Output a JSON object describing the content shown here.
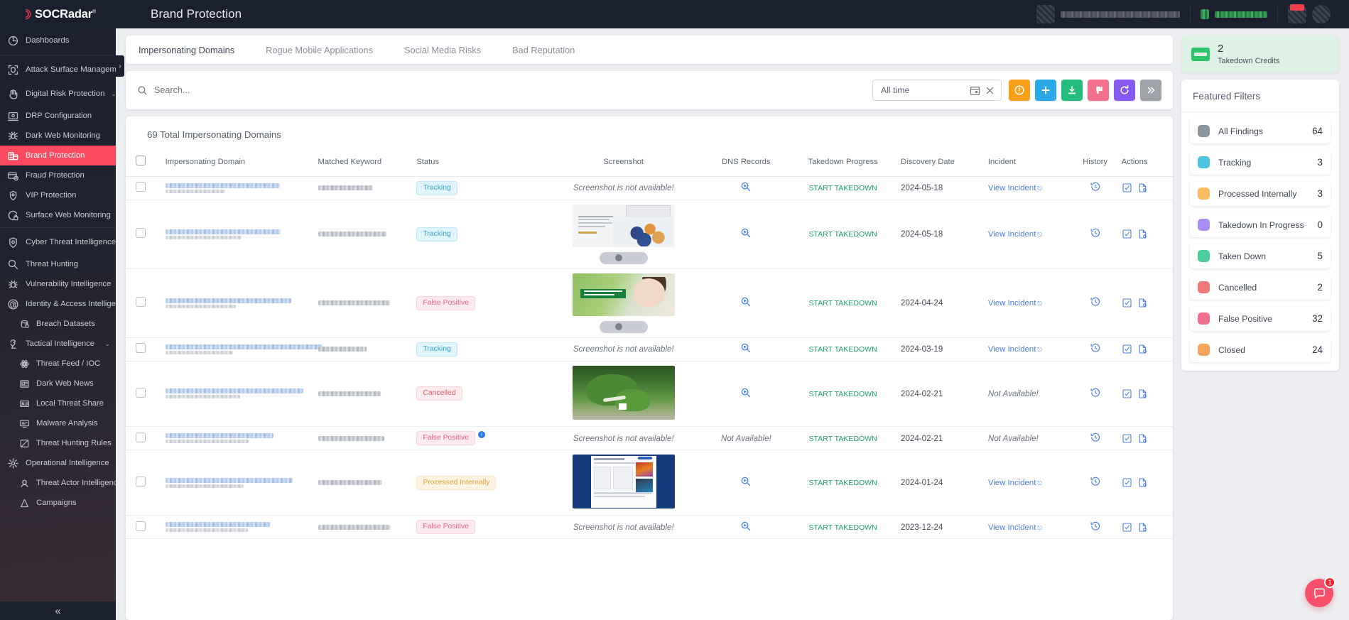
{
  "header": {
    "logo_text": "SOCRadar",
    "logo_sup": "®",
    "page_title": "Brand Protection",
    "avatar_icon": "user-avatar",
    "globe_icon": "globe-icon"
  },
  "sidebar": {
    "collapse_label": "«",
    "flyout_label": "›",
    "items": [
      {
        "label": "Dashboards",
        "icon": "dashboard-icon",
        "type": "header",
        "active": false,
        "chevron": ""
      },
      {
        "label": "Attack Surface Management",
        "icon": "shield-scan-icon",
        "type": "header",
        "active": false,
        "chevron": "›"
      },
      {
        "label": "Digital Risk Protection",
        "icon": "hand-icon",
        "type": "header",
        "active": false,
        "chevron": "⌄"
      },
      {
        "label": "DRP Configuration",
        "icon": "monitor-icon",
        "type": "item",
        "active": false,
        "chevron": ""
      },
      {
        "label": "Dark Web Monitoring",
        "icon": "spider-icon",
        "type": "item",
        "active": false,
        "chevron": ""
      },
      {
        "label": "Brand Protection",
        "icon": "building-icon",
        "type": "item",
        "active": true,
        "chevron": ""
      },
      {
        "label": "Fraud Protection",
        "icon": "card-fraud-icon",
        "type": "item",
        "active": false,
        "chevron": ""
      },
      {
        "label": "VIP Protection",
        "icon": "shield-person-icon",
        "type": "item",
        "active": false,
        "chevron": ""
      },
      {
        "label": "Surface Web Monitoring",
        "icon": "web-lock-icon",
        "type": "item",
        "active": false,
        "chevron": ""
      },
      {
        "label": "Cyber Threat Intelligence",
        "icon": "eye-shield-icon",
        "type": "header",
        "active": false,
        "chevron": "⌄",
        "badge": "?"
      },
      {
        "label": "Threat Hunting",
        "icon": "search-icon",
        "type": "item",
        "active": false,
        "chevron": ""
      },
      {
        "label": "Vulnerability Intelligence",
        "icon": "bug-icon",
        "type": "item",
        "active": false,
        "chevron": ""
      },
      {
        "label": "Identity & Access Intelligence",
        "icon": "fingerprint-icon",
        "type": "item",
        "active": false,
        "chevron": "⌄"
      },
      {
        "label": "Breach Datasets",
        "icon": "database-lock-icon",
        "type": "sub",
        "active": false,
        "chevron": ""
      },
      {
        "label": "Tactical Intelligence",
        "icon": "chess-icon",
        "type": "item",
        "active": false,
        "chevron": "⌄"
      },
      {
        "label": "Threat Feed / IOC",
        "icon": "atom-icon",
        "type": "sub",
        "active": false,
        "chevron": ""
      },
      {
        "label": "Dark Web News",
        "icon": "news-icon",
        "type": "sub",
        "active": false,
        "chevron": ""
      },
      {
        "label": "Local Threat Share",
        "icon": "share-card-icon",
        "type": "sub",
        "active": false,
        "chevron": ""
      },
      {
        "label": "Malware Analysis",
        "icon": "malware-icon",
        "type": "sub",
        "active": false,
        "chevron": ""
      },
      {
        "label": "Threat Hunting Rules",
        "icon": "rules-icon",
        "type": "sub",
        "active": false,
        "chevron": ""
      },
      {
        "label": "Operational Intelligence",
        "icon": "gear-star-icon",
        "type": "item",
        "active": false,
        "chevron": "⌄"
      },
      {
        "label": "Threat Actor Intelligence",
        "icon": "actor-icon",
        "type": "sub",
        "active": false,
        "chevron": ""
      },
      {
        "label": "Campaigns",
        "icon": "campaign-icon",
        "type": "sub",
        "active": false,
        "chevron": ""
      }
    ]
  },
  "tabs": [
    {
      "label": "Impersonating Domains",
      "active": true
    },
    {
      "label": "Rogue Mobile Applications",
      "active": false
    },
    {
      "label": "Social Media Risks",
      "active": false
    },
    {
      "label": "Bad Reputation",
      "active": false
    }
  ],
  "search": {
    "placeholder": "Search...",
    "value": "",
    "icon": "search-icon"
  },
  "daterange": {
    "value": "All time",
    "calendar_icon": "calendar-icon",
    "clear_icon": "close-icon"
  },
  "action_buttons": [
    {
      "name": "alert-button",
      "icon": "exclamation-circle-icon",
      "color": "#f5a018"
    },
    {
      "name": "add-button",
      "icon": "plus-icon",
      "color": "#2aa8e8"
    },
    {
      "name": "download-button",
      "icon": "download-icon",
      "color": "#24bb7e"
    },
    {
      "name": "dislike-button",
      "icon": "thumbs-down-icon",
      "color": "#f4718e"
    },
    {
      "name": "refresh-button",
      "icon": "refresh-icon",
      "color": "#8659f0"
    },
    {
      "name": "more-button",
      "icon": "double-chevron-right-icon",
      "color": "#9fa3a9"
    }
  ],
  "table": {
    "title": "69 Total Impersonating Domains",
    "columns": [
      "Impersonating Domain",
      "Matched Keyword",
      "Status",
      "Screenshot",
      "DNS Records",
      "Takedown Progress",
      "Discovery Date",
      "Incident",
      "History",
      "Actions"
    ],
    "takedown_label": "START TAKEDOWN",
    "incident_label": "View Incident",
    "screenshot_na": "Screenshot is not available!",
    "not_available": "Not Available!",
    "rows": [
      {
        "status": "Tracking",
        "status_class": "b-tracking",
        "info": false,
        "screenshot": "none",
        "dns": "icon",
        "takedown": "START TAKEDOWN",
        "date": "2024-05-18",
        "incident": "View Incident"
      },
      {
        "status": "Tracking",
        "status_class": "b-tracking",
        "info": false,
        "screenshot": "image1",
        "dns": "icon",
        "takedown": "START TAKEDOWN",
        "date": "2024-05-18",
        "incident": "View Incident"
      },
      {
        "status": "False Positive",
        "status_class": "b-false",
        "info": false,
        "screenshot": "image2",
        "dns": "icon",
        "takedown": "START TAKEDOWN",
        "date": "2024-04-24",
        "incident": "View Incident"
      },
      {
        "status": "Tracking",
        "status_class": "b-tracking",
        "info": false,
        "screenshot": "none",
        "dns": "icon",
        "takedown": "START TAKEDOWN",
        "date": "2024-03-19",
        "incident": "View Incident"
      },
      {
        "status": "Cancelled",
        "status_class": "b-cancelled",
        "info": false,
        "screenshot": "image3",
        "dns": "icon",
        "takedown": "START TAKEDOWN",
        "date": "2024-02-21",
        "incident": "Not Available!"
      },
      {
        "status": "False Positive",
        "status_class": "b-false",
        "info": true,
        "screenshot": "none",
        "dns": "na",
        "takedown": "START TAKEDOWN",
        "date": "2024-02-21",
        "incident": "Not Available!"
      },
      {
        "status": "Processed Internally",
        "status_class": "b-processed",
        "info": false,
        "screenshot": "image4",
        "dns": "icon",
        "takedown": "START TAKEDOWN",
        "date": "2024-01-24",
        "incident": "View Incident"
      },
      {
        "status": "False Positive",
        "status_class": "b-false",
        "info": false,
        "screenshot": "none",
        "dns": "icon",
        "takedown": "START TAKEDOWN",
        "date": "2023-12-24",
        "incident": "View Incident"
      }
    ]
  },
  "credits": {
    "count": "2",
    "label": "Takedown Credits",
    "icon": "credit-card-icon"
  },
  "featured_filters": {
    "title": "Featured Filters",
    "items": [
      {
        "label": "All Findings",
        "count": "64",
        "color": "#8e949e"
      },
      {
        "label": "Tracking",
        "count": "3",
        "color": "#4cc4e0"
      },
      {
        "label": "Processed Internally",
        "count": "3",
        "color": "#f9bc5e"
      },
      {
        "label": "Takedown In Progress",
        "count": "0",
        "color": "#a98cf5"
      },
      {
        "label": "Taken Down",
        "count": "5",
        "color": "#4ccb9b"
      },
      {
        "label": "Cancelled",
        "count": "2",
        "color": "#ef7a7a"
      },
      {
        "label": "False Positive",
        "count": "32",
        "color": "#f2708f"
      },
      {
        "label": "Closed",
        "count": "24",
        "color": "#f5a45c"
      }
    ]
  },
  "chat": {
    "icon": "chat-icon",
    "count": "1"
  }
}
